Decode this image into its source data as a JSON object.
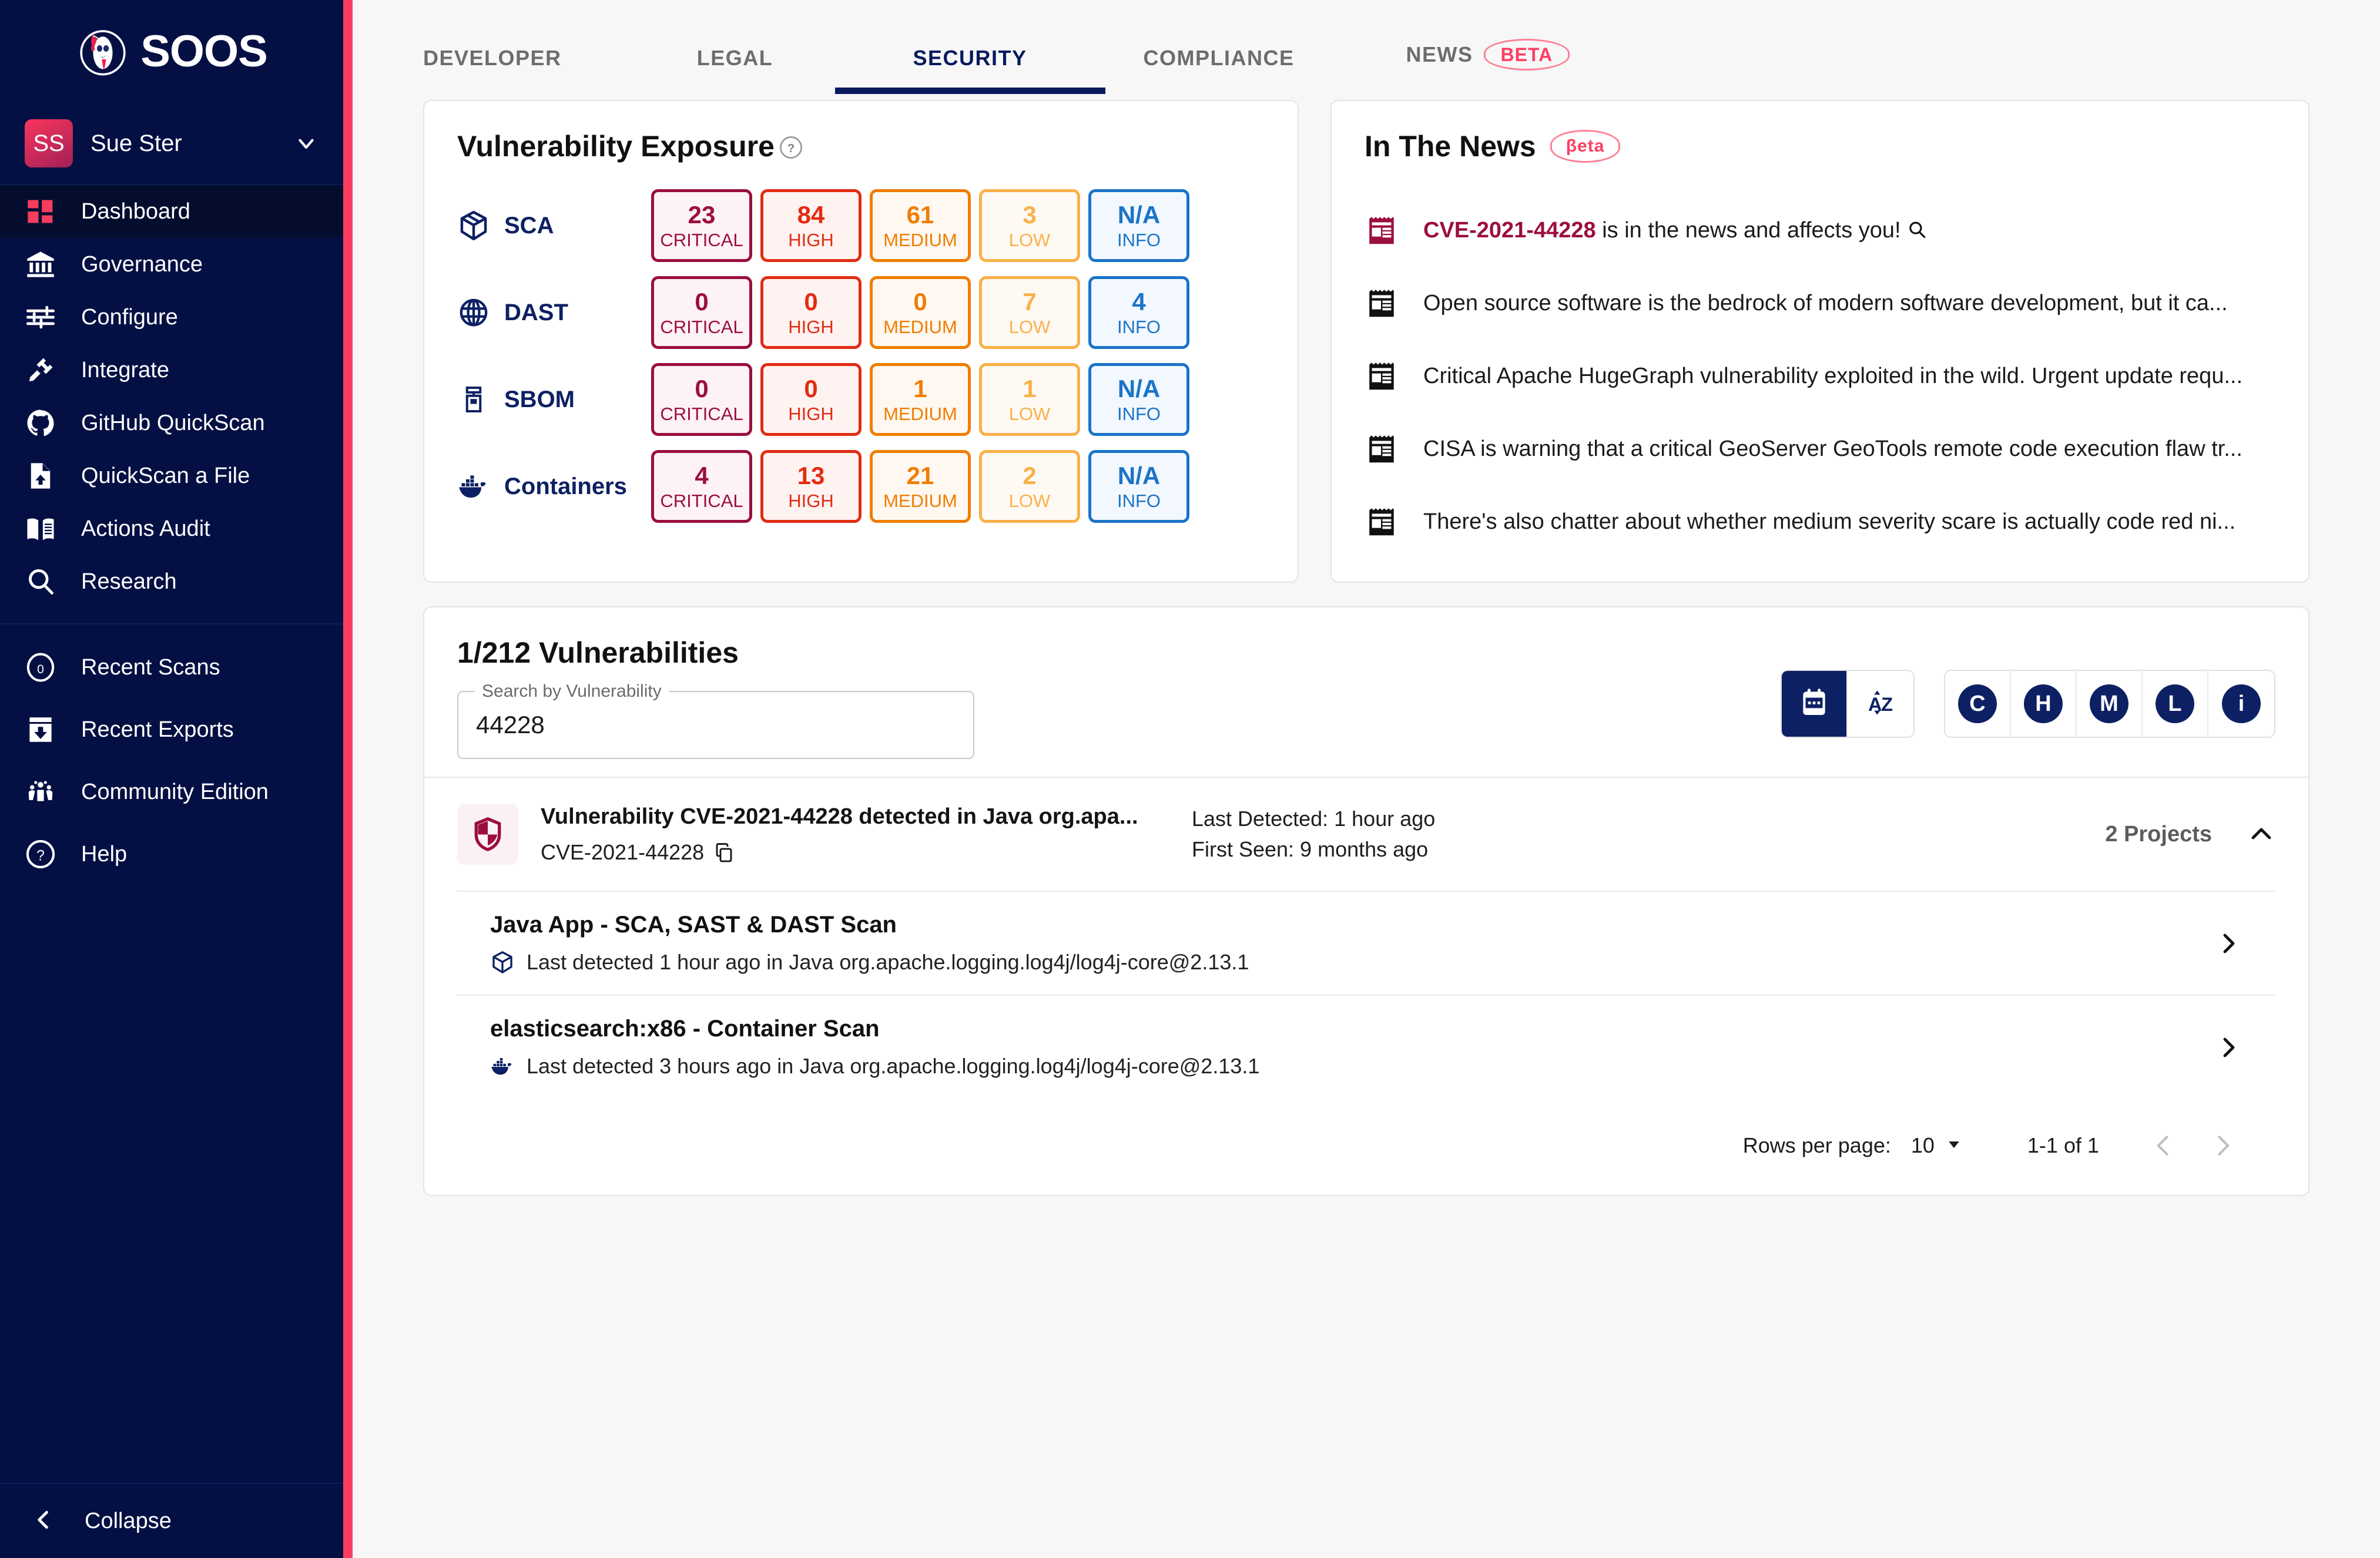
{
  "brand": {
    "name": "SOOS",
    "logo_icon": "soos-rooster-logo"
  },
  "user": {
    "initials": "SS",
    "name": "Sue Ster"
  },
  "sidebar": {
    "items": [
      {
        "label": "Dashboard",
        "icon": "grid-icon",
        "active": true
      },
      {
        "label": "Governance",
        "icon": "bank-icon",
        "active": false
      },
      {
        "label": "Configure",
        "icon": "sliders-icon",
        "active": false
      },
      {
        "label": "Integrate",
        "icon": "plug-icon",
        "active": false
      },
      {
        "label": "GitHub QuickScan",
        "icon": "github-icon",
        "active": false
      },
      {
        "label": "QuickScan a File",
        "icon": "file-upload-icon",
        "active": false
      },
      {
        "label": "Actions Audit",
        "icon": "book-icon",
        "active": false
      },
      {
        "label": "Research",
        "icon": "search-icon",
        "active": false
      }
    ],
    "secondary_items": [
      {
        "label": "Recent Scans",
        "icon": "counter-zero-icon",
        "badge": "0"
      },
      {
        "label": "Recent Exports",
        "icon": "download-box-icon"
      },
      {
        "label": "Community Edition",
        "icon": "community-icon"
      },
      {
        "label": "Help",
        "icon": "question-circle-icon"
      }
    ],
    "collapse_label": "Collapse",
    "collapse_icon": "chevron-left-icon"
  },
  "topnav": {
    "tabs": [
      {
        "label": "DEVELOPER",
        "active": false
      },
      {
        "label": "LEGAL",
        "active": false
      },
      {
        "label": "SECURITY",
        "active": true
      },
      {
        "label": "COMPLIANCE",
        "active": false
      },
      {
        "label": "NEWS",
        "active": false,
        "badge": "BETA"
      }
    ]
  },
  "vulnerability_exposure": {
    "title": "Vulnerability Exposure",
    "help_icon": "question-circle-icon",
    "columns": [
      "CRITICAL",
      "HIGH",
      "MEDIUM",
      "LOW",
      "INFO"
    ],
    "rows": [
      {
        "label": "SCA",
        "icon": "package-icon",
        "values": [
          "23",
          "84",
          "61",
          "3",
          "N/A"
        ]
      },
      {
        "label": "DAST",
        "icon": "globe-icon",
        "values": [
          "0",
          "0",
          "0",
          "7",
          "4"
        ]
      },
      {
        "label": "SBOM",
        "icon": "sbom-icon",
        "values": [
          "0",
          "0",
          "1",
          "1",
          "N/A"
        ]
      },
      {
        "label": "Containers",
        "icon": "docker-icon",
        "values": [
          "4",
          "13",
          "21",
          "2",
          "N/A"
        ]
      }
    ]
  },
  "news": {
    "title": "In The News",
    "badge": "βeta",
    "items": [
      {
        "icon": "newspaper-icon",
        "highlight": "CVE-2021-44228",
        "text": " is in the news and affects you!",
        "has_search_icon": true,
        "accent": true
      },
      {
        "icon": "newspaper-icon",
        "text": "Open source software is the bedrock of modern software development, but it ca...",
        "accent": false
      },
      {
        "icon": "newspaper-icon",
        "text": "Critical Apache HugeGraph vulnerability exploited in the wild. Urgent update requ...",
        "accent": false
      },
      {
        "icon": "newspaper-icon",
        "text": "CISA is warning that a critical GeoServer GeoTools remote code execution flaw tr...",
        "accent": false
      },
      {
        "icon": "newspaper-icon",
        "text": "There's also chatter about whether medium severity scare is actually code red ni...",
        "accent": false
      }
    ]
  },
  "vuln_list": {
    "title": "1/212 Vulnerabilities",
    "search": {
      "legend": "Search by Vulnerability",
      "value": "44228",
      "placeholder": ""
    },
    "sort_buttons": [
      {
        "icon": "calendar-icon",
        "name": "sort-by-date",
        "active": true
      },
      {
        "icon": "az-sort-icon",
        "name": "sort-alphabetical",
        "active": false
      }
    ],
    "severity_filters": [
      {
        "letter": "C",
        "name": "filter-critical"
      },
      {
        "letter": "H",
        "name": "filter-high"
      },
      {
        "letter": "M",
        "name": "filter-medium"
      },
      {
        "letter": "L",
        "name": "filter-low"
      },
      {
        "letter": "i",
        "name": "filter-info"
      }
    ],
    "result": {
      "icon": "shield-icon",
      "title": "Vulnerability CVE-2021-44228 detected in Java org.apa...",
      "cve_id": "CVE-2021-44228",
      "copy_icon": "copy-icon",
      "last_detected": "Last Detected: 1 hour ago",
      "first_seen": "First Seen: 9 months ago",
      "projects_count": "2 Projects",
      "expand_icon": "chevron-up-icon"
    },
    "projects": [
      {
        "title": "Java App - SCA, SAST & DAST Scan",
        "icon": "package-icon",
        "detail": "Last detected 1 hour ago in Java org.apache.logging.log4j/log4j-core@2.13.1",
        "chevron": "chevron-right-icon"
      },
      {
        "title": "elasticsearch:x86 - Container Scan",
        "icon": "docker-icon",
        "detail": "Last detected 3 hours ago in Java org.apache.logging.log4j/log4j-core@2.13.1",
        "chevron": "chevron-right-icon"
      }
    ],
    "pager": {
      "rows_label": "Rows per page:",
      "rows_value": "10",
      "range": "1-1 of 1",
      "prev_icon": "chevron-left-icon",
      "next_icon": "chevron-right-icon"
    }
  },
  "colors": {
    "sidebar_bg": "#041043",
    "accent_pink": "#ff3d60",
    "navy": "#0d2063",
    "critical": "#9b0f3c",
    "high": "#e32c12",
    "medium": "#f07d00",
    "low": "#fab04a",
    "info": "#1b74c8",
    "page_bg": "#f7f7f8"
  }
}
